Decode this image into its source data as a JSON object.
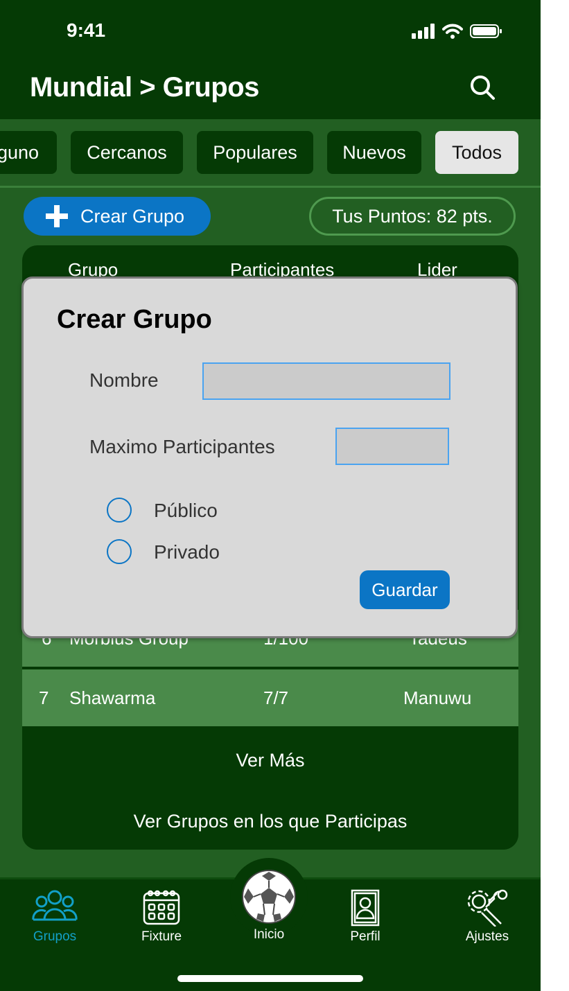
{
  "status_bar": {
    "time": "9:41"
  },
  "header": {
    "title": "Mundial > Grupos"
  },
  "filters": [
    "guno",
    "Cercanos",
    "Populares",
    "Nuevos",
    "Todos"
  ],
  "active_filter": "Todos",
  "actions": {
    "create_label": "Crear Grupo",
    "points_label": "Tus Puntos: 82 pts."
  },
  "table": {
    "headers": [
      "Grupo",
      "Participantes",
      "Lider"
    ],
    "rows": [
      {
        "num": "6",
        "name": "Morbius Group",
        "participants": "1/100",
        "leader": "Tadeus"
      },
      {
        "num": "7",
        "name": "Shawarma",
        "participants": "7/7",
        "leader": "Manuwu"
      }
    ]
  },
  "buttons": {
    "ver_mas": "Ver Más",
    "ver_participas": "Ver Grupos en los que Participas"
  },
  "modal": {
    "title": "Crear Grupo",
    "name_label": "Nombre",
    "name_value": "",
    "max_label": "Maximo Participantes",
    "max_value": "",
    "option_public": "Público",
    "option_private": "Privado",
    "save_label": "Guardar"
  },
  "tabs": [
    {
      "label": "Grupos",
      "icon": "groups-icon",
      "active": true
    },
    {
      "label": "Fixture",
      "icon": "calendar-icon"
    },
    {
      "label": "Inicio",
      "icon": "soccer-ball-icon"
    },
    {
      "label": "Perfil",
      "icon": "profile-icon"
    },
    {
      "label": "Ajustes",
      "icon": "settings-icon"
    }
  ],
  "colors": {
    "primary_blue": "#0b75c5",
    "dark_green": "#053a05",
    "mid_green": "#225f22",
    "row_green": "#4a8a4a",
    "active_tab": "#12a0c8"
  }
}
